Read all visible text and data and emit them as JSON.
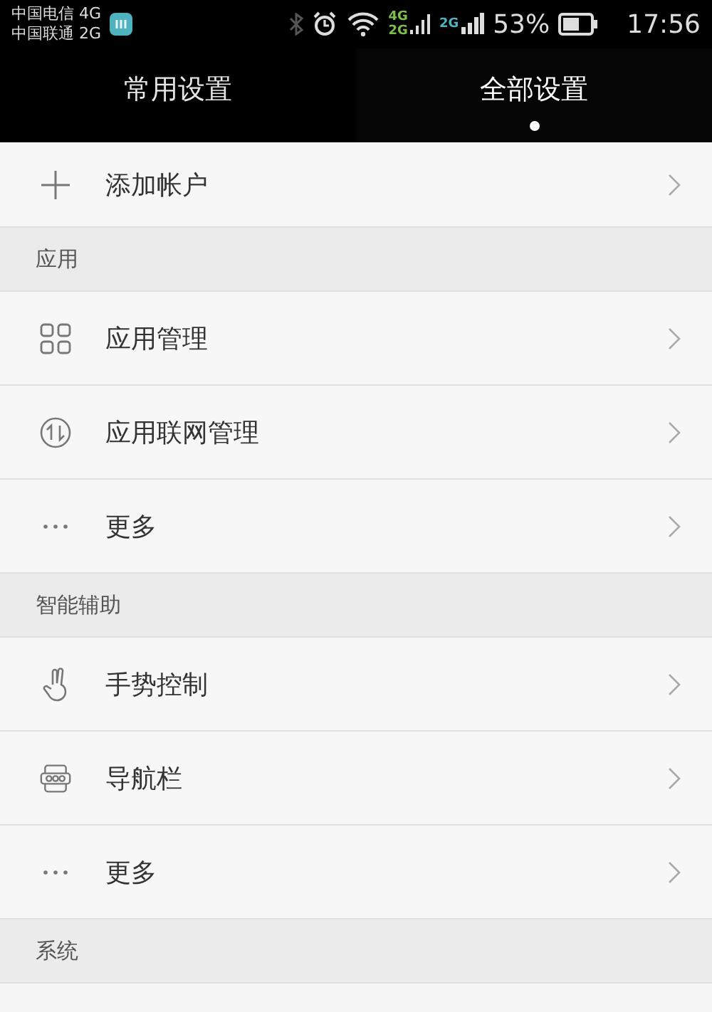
{
  "status_bar": {
    "carriers": [
      "中国电信 4G",
      "中国联通 2G"
    ],
    "sim1_network": "4G",
    "sim1_network_2": "2G",
    "sim2_network": "2G",
    "battery": "53%",
    "time": "17:56"
  },
  "tabs": [
    {
      "label": "常用设置",
      "selected": false
    },
    {
      "label": "全部设置",
      "selected": true
    }
  ],
  "top_items": [
    {
      "label": "添加帐户"
    }
  ],
  "sections": [
    {
      "title": "应用",
      "items": [
        {
          "label": "应用管理"
        },
        {
          "label": "应用联网管理"
        },
        {
          "label": "更多"
        }
      ]
    },
    {
      "title": "智能辅助",
      "items": [
        {
          "label": "手势控制"
        },
        {
          "label": "导航栏"
        },
        {
          "label": "更多"
        }
      ]
    },
    {
      "title": "系统"
    }
  ]
}
